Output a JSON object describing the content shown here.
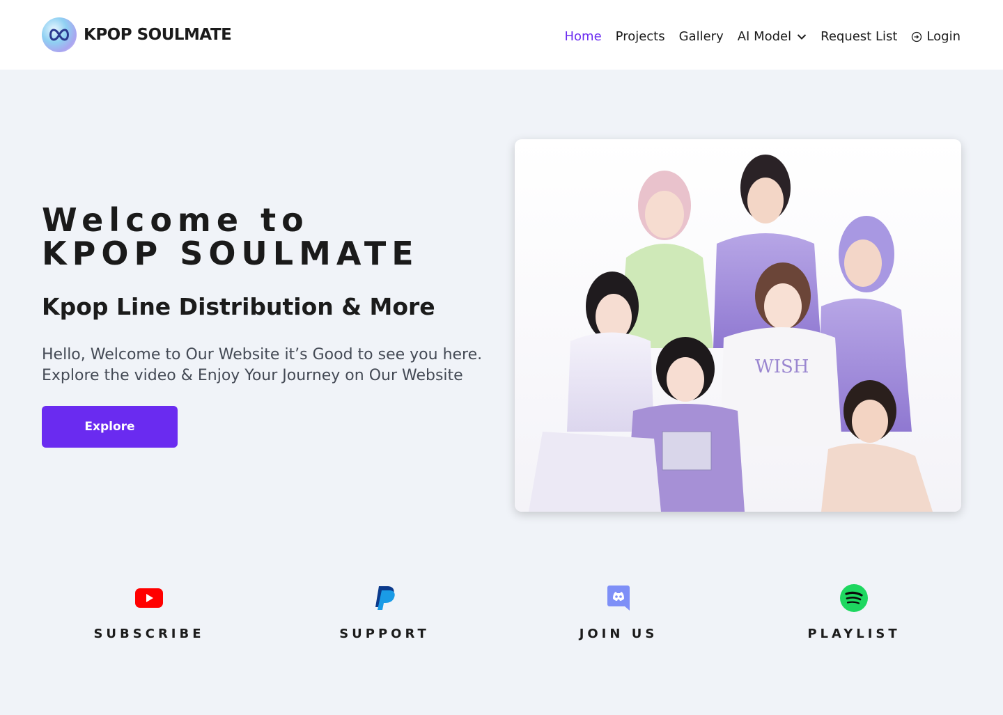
{
  "brand": {
    "name": "KPOP SOULMATE"
  },
  "nav": {
    "items": [
      {
        "label": "Home",
        "active": true
      },
      {
        "label": "Projects"
      },
      {
        "label": "Gallery"
      },
      {
        "label": "AI Model",
        "icon": "chevron-down-icon"
      },
      {
        "label": "Request List"
      },
      {
        "label": "Login",
        "icon": "login-icon"
      }
    ]
  },
  "hero": {
    "title_line1": "Welcome to",
    "title_line2": "KPOP SOULMATE",
    "subtitle": "Kpop Line Distribution & More",
    "desc_line1": "Hello, Welcome to Our Website it’s Good to see you here.",
    "desc_line2": "Explore the video & Enjoy Your Journey on Our Website",
    "button": "Explore",
    "image": "group-photo"
  },
  "socials": [
    {
      "label": "SUBSCRIBE",
      "icon": "youtube-icon"
    },
    {
      "label": "SUPPORT",
      "icon": "paypal-icon"
    },
    {
      "label": "JOIN US",
      "icon": "discord-icon"
    },
    {
      "label": "PLAYLIST",
      "icon": "spotify-icon"
    }
  ],
  "colors": {
    "accent": "#6a2bf0",
    "background": "#f0f3f8",
    "youtube": "#ff0000",
    "paypal": "#0088cc",
    "discord": "#7e8ff7",
    "spotify": "#1ed760"
  }
}
